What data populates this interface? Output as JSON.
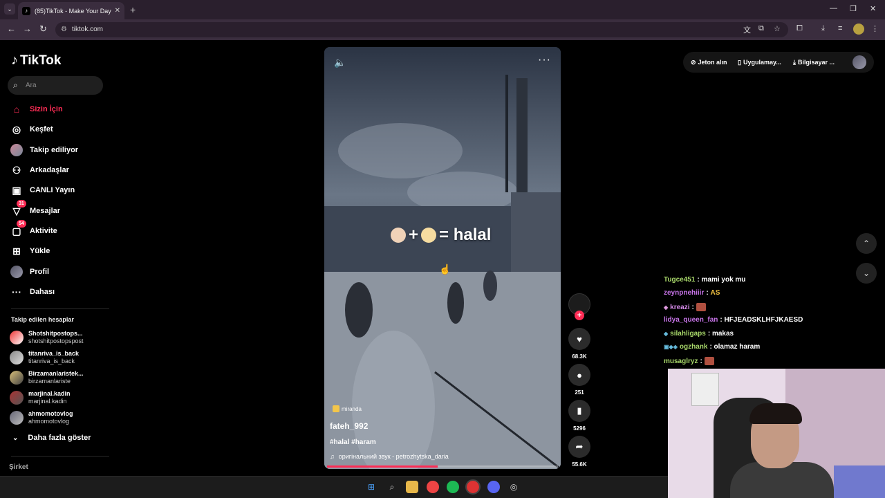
{
  "browser": {
    "tab_title": "(85)TikTok - Make Your Day",
    "favicon": "tiktok-icon",
    "url": "tiktok.com"
  },
  "sidebar": {
    "logo": "TikTok",
    "search_placeholder": "Ara",
    "items": [
      {
        "label": "Sizin İçin",
        "icon": "home-icon",
        "active": true
      },
      {
        "label": "Keşfet",
        "icon": "compass-icon"
      },
      {
        "label": "Takip ediliyor",
        "icon": "avatar-icon"
      },
      {
        "label": "Arkadaşlar",
        "icon": "friends-icon"
      },
      {
        "label": "CANLI Yayın",
        "icon": "live-icon"
      },
      {
        "label": "Mesajlar",
        "icon": "messages-icon",
        "badge": "31"
      },
      {
        "label": "Aktivite",
        "icon": "activity-icon",
        "badge": "54"
      },
      {
        "label": "Yükle",
        "icon": "upload-icon"
      },
      {
        "label": "Profil",
        "icon": "profile-icon"
      },
      {
        "label": "Dahası",
        "icon": "more-icon"
      }
    ],
    "following_heading": "Takip edilen hesaplar",
    "accounts": [
      {
        "name": "Shotshitpostops...",
        "handle": "shotshitpostopspost"
      },
      {
        "name": "titanriva_is_back",
        "handle": "titanriva_is_back"
      },
      {
        "name": "Birzamanlaristek...",
        "handle": "birzamanlariste"
      },
      {
        "name": "marjinal.kadin",
        "handle": "marjinal.kadin"
      },
      {
        "name": "ahmomotovlog",
        "handle": "ahmomotovlog"
      }
    ],
    "show_more": "Daha fazla göster",
    "company": "Şirket"
  },
  "header": {
    "coins": "Jeton alın",
    "app": "Uygulamay...",
    "computer": "Bilgisayar ..."
  },
  "video": {
    "overlay_plus": "+",
    "overlay_eq": "= halal",
    "tag_pill": "miranda",
    "author": "fateh_992",
    "hashtags": "#halal #haram",
    "sound": "оригінальний звук - petrozhytska_daria",
    "progress": 0.48
  },
  "actions": {
    "likes": "68.3K",
    "comments": "251",
    "saves": "5296",
    "shares": "55.6K"
  },
  "chat": [
    {
      "user": "Tugce451",
      "color": "#a8d86a",
      "msg": "mami yok mu"
    },
    {
      "user": "zeynpnehiiir",
      "color": "#c774e8",
      "msg": "AS"
    },
    {
      "user": "kreazi",
      "color": "#d58ae8",
      "msg": ""
    },
    {
      "user": "lidya_queen_fan",
      "color": "#c774e8",
      "msg": "HFJEADSKLHFJKAESD"
    },
    {
      "user": "silahligaps",
      "color": "#a8d86a",
      "msg": "makas"
    },
    {
      "user": "ogzhank",
      "color": "#a8d86a",
      "msg": "olamaz haram"
    },
    {
      "user": "musaglryz",
      "color": "#a8d86a",
      "msg": ""
    }
  ],
  "colors": {
    "accent": "#fe2c55",
    "chrome": "#3a2d3e"
  }
}
